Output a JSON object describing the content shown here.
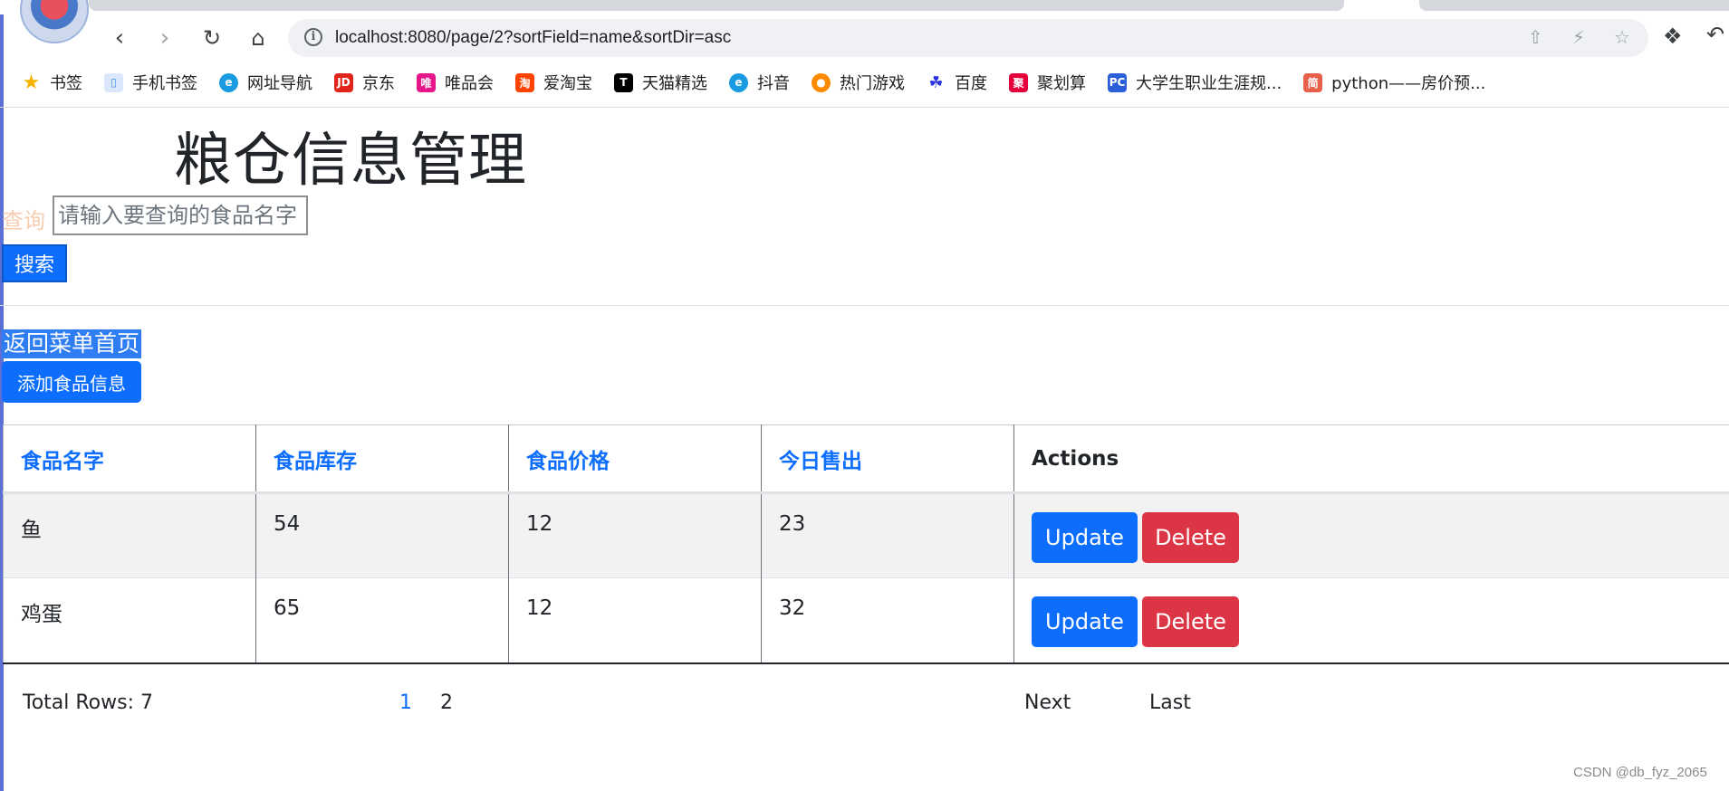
{
  "browser": {
    "url": "localhost:8080/page/2?sortField=name&sortDir=asc",
    "bookmarks": [
      {
        "label": "书签",
        "icon": "star-icon",
        "color": "#f4b400"
      },
      {
        "label": "手机书签",
        "icon": "phone-icon",
        "color": "#4a90e2"
      },
      {
        "label": "网址导航",
        "icon": "browser-e-icon",
        "color": "#1a9ae0"
      },
      {
        "label": "京东",
        "icon": "jd-icon",
        "color": "#e1251b",
        "glyph": "JD"
      },
      {
        "label": "唯品会",
        "icon": "vip-icon",
        "color": "#e7168b",
        "glyph": "唯"
      },
      {
        "label": "爱淘宝",
        "icon": "taobao-icon",
        "color": "#ff4400",
        "glyph": "淘"
      },
      {
        "label": "天猫精选",
        "icon": "tmall-icon",
        "color": "#000000",
        "glyph": "T"
      },
      {
        "label": "抖音",
        "icon": "browser-e-icon",
        "color": "#1a9ae0"
      },
      {
        "label": "热门游戏",
        "icon": "game-icon",
        "color": "#ff8a00"
      },
      {
        "label": "百度",
        "icon": "baidu-paw-icon",
        "color": "#2932e1"
      },
      {
        "label": "聚划算",
        "icon": "juhuasuan-icon",
        "color": "#e5003b",
        "glyph": "聚"
      },
      {
        "label": "大学生职业生涯规...",
        "icon": "pc-icon",
        "color": "#2b5fd9",
        "glyph": "PC"
      },
      {
        "label": "python——房价预...",
        "icon": "jian-icon",
        "color": "#e8604c",
        "glyph": "简"
      }
    ]
  },
  "page": {
    "title": "粮仓信息管理",
    "search": {
      "label": "查询",
      "placeholder": "请输入要查询的食品名字",
      "button": "搜索"
    },
    "back_link": "返回菜单首页",
    "add_button": "添加食品信息"
  },
  "table": {
    "headers": [
      "食品名字",
      "食品库存",
      "食品价格",
      "今日售出",
      "Actions"
    ],
    "rows": [
      {
        "name": "鱼",
        "stock": "54",
        "price": "12",
        "sold": "23"
      },
      {
        "name": "鸡蛋",
        "stock": "65",
        "price": "12",
        "sold": "32"
      }
    ],
    "update_label": "Update",
    "delete_label": "Delete"
  },
  "pagination": {
    "total": "Total Rows: 7",
    "pages": [
      "1",
      "2"
    ],
    "next": "Next",
    "last": "Last"
  },
  "watermark": "CSDN @db_fyz_2065",
  "colors": {
    "primary": "#0d6efd",
    "danger": "#dc3545",
    "query_label": "#f7cdb0"
  }
}
